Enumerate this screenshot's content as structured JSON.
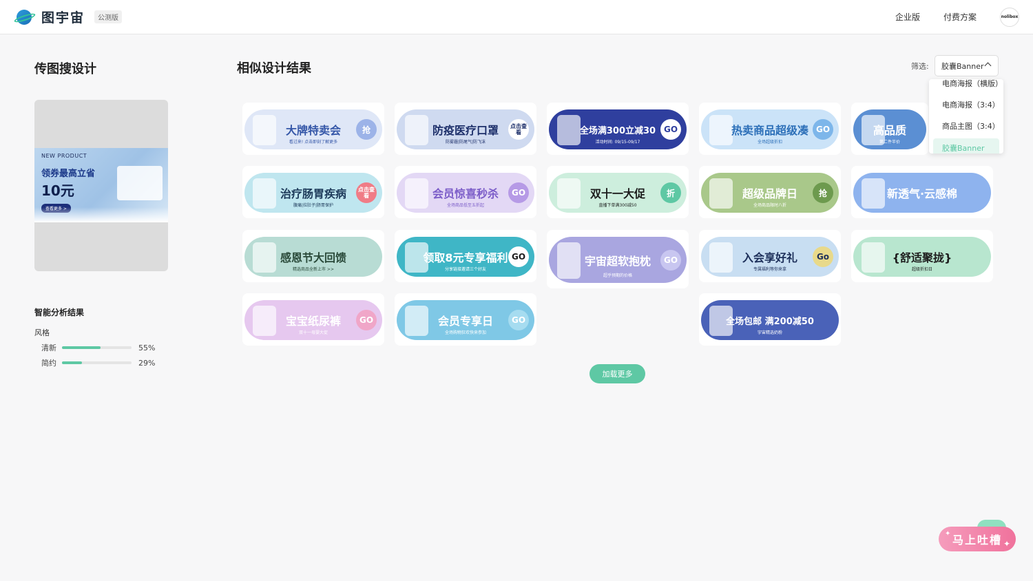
{
  "header": {
    "logo_text": "图宇宙",
    "beta_label": "公测版",
    "nav": [
      "企业版",
      "付费方案"
    ],
    "avatar_text": "nolibox"
  },
  "left": {
    "title": "传图搜设计",
    "upload": {
      "new_product": "NEW PRODUCT",
      "headline": "领券最高立省",
      "price": "10元",
      "button": "查看更多 >"
    },
    "analysis_title": "智能分析结果",
    "style_label": "风格",
    "styles": [
      {
        "name": "清新",
        "percent": 55,
        "label": "55%"
      },
      {
        "name": "简约",
        "percent": 29,
        "label": "29%"
      }
    ]
  },
  "right": {
    "title": "相似设计结果",
    "filter_label": "筛选:",
    "filter_value": "胶囊Banner",
    "dropdown": [
      "电商海报（横版）",
      "电商海报（3:4）",
      "商品主图（3:4）",
      "胶囊Banner"
    ],
    "cards": [
      {
        "text": "大牌特卖会",
        "sub": "看过来! 点击即刻了解更多",
        "go": "抢",
        "bg": "#dfe7f7",
        "fg": "#3557a8",
        "gobg": "#9cb3e8",
        "gofg": "#ffffff"
      },
      {
        "text": "防疫医疗口罩",
        "sub": "防雾霾|防尾气|防飞沫",
        "go": "点击查看",
        "bg": "#cfdaf0",
        "fg": "#1d2f6a",
        "gobg": "#ffffff",
        "gofg": "#1d2f6a"
      },
      {
        "text": "全场满300立减30",
        "sub": "活动时间: 09/15-09/17",
        "go": "GO",
        "bg": "#2f3f9e",
        "fg": "#ffffff",
        "gobg": "#ffffff",
        "gofg": "#2f3f9e"
      },
      {
        "text": "热卖商品超级凑",
        "sub": "全场超级折扣",
        "go": "GO",
        "bg": "#cbe3f8",
        "fg": "#2c6fb8",
        "gobg": "#7db6ea",
        "gofg": "#ffffff"
      },
      {
        "text": "高品质",
        "sub": "第二件半价",
        "go": "",
        "bg": "#5b8fd3",
        "fg": "#ffffff",
        "gobg": "#5b8fd3",
        "gofg": "#ffffff"
      },
      {
        "text": "治疗肠胃疾病",
        "sub": "腹痛|拉肚子|肠胃保护",
        "go": "点击查看",
        "bg": "#bfe6ef",
        "fg": "#1d3a5a",
        "gobg": "#f07c86",
        "gofg": "#ffffff"
      },
      {
        "text": "会员惊喜秒杀",
        "sub": "全场商品低至五折起",
        "go": "GO",
        "bg": "#e3d8f5",
        "fg": "#7b5cc8",
        "gobg": "#b69ae6",
        "gofg": "#ffffff"
      },
      {
        "text": "双十一大促",
        "sub": "直播下单满300减50",
        "go": "折",
        "bg": "#cdeedd",
        "fg": "#1d1d1d",
        "gobg": "#5ec8a4",
        "gofg": "#ffffff"
      },
      {
        "text": "超级品牌日",
        "sub": "全场商品限时八折",
        "go": "抢",
        "bg": "#a9c88a",
        "fg": "#ffffff",
        "gobg": "#6d9a4e",
        "gofg": "#ffffff"
      },
      {
        "text": "新透气·云感棉",
        "sub": "",
        "go": "",
        "bg": "#8eb3ee",
        "fg": "#ffffff",
        "gobg": "#8eb3ee",
        "gofg": "#ffffff"
      },
      {
        "text": "感恩节大回馈",
        "sub": "精选商品全新上市 >>",
        "go": "",
        "bg": "#b8dcd4",
        "fg": "#2a4a3a",
        "gobg": "#b8dcd4",
        "gofg": "#2a4a3a"
      },
      {
        "text": "领取8元专享福利",
        "sub": "分享链接邀请三个好友",
        "go": "GO",
        "bg": "#3fb6c6",
        "fg": "#ffffff",
        "gobg": "#ffffff",
        "gofg": "#1d1d1d"
      },
      {
        "text": "宇宙超软抱枕",
        "sub": "超乎预期的价格",
        "go": "GO",
        "bg": "#a9a6e0",
        "fg": "#ffffff",
        "gobg": "#c8c6f0",
        "gofg": "#ffffff"
      },
      {
        "text": "入会享好礼",
        "sub": "专属福利等你来拿",
        "go": "Go",
        "bg": "#c8def2",
        "fg": "#1d2f5a",
        "gobg": "#e8d98a",
        "gofg": "#1d2f5a"
      },
      {
        "text": "{舒适聚拢}",
        "sub": "超级折扣日",
        "go": "",
        "bg": "#b8e6cf",
        "fg": "#1d1d1d",
        "gobg": "#b8e6cf",
        "gofg": "#1d1d1d"
      },
      {
        "text": "宝宝纸尿裤",
        "sub": "双十一母婴大促",
        "go": "GO",
        "bg": "#e6c8ef",
        "fg": "#ffffff",
        "gobg": "#f0a6c8",
        "gofg": "#ffffff"
      },
      {
        "text": "会员专享日",
        "sub": "全场购物狂欢快来参加",
        "go": "GO",
        "bg": "#7fc8e6",
        "fg": "#ffffff",
        "gobg": "#a6dcf0",
        "gofg": "#ffffff"
      },
      {
        "text": "全场包邮 满200减50",
        "sub": "宇宙精选奶粉",
        "go": "",
        "bg": "#4a62b8",
        "fg": "#ffffff",
        "gobg": "#4a62b8",
        "gofg": "#ffffff"
      }
    ],
    "load_more": "加载更多"
  },
  "feedback": "马上吐槽"
}
